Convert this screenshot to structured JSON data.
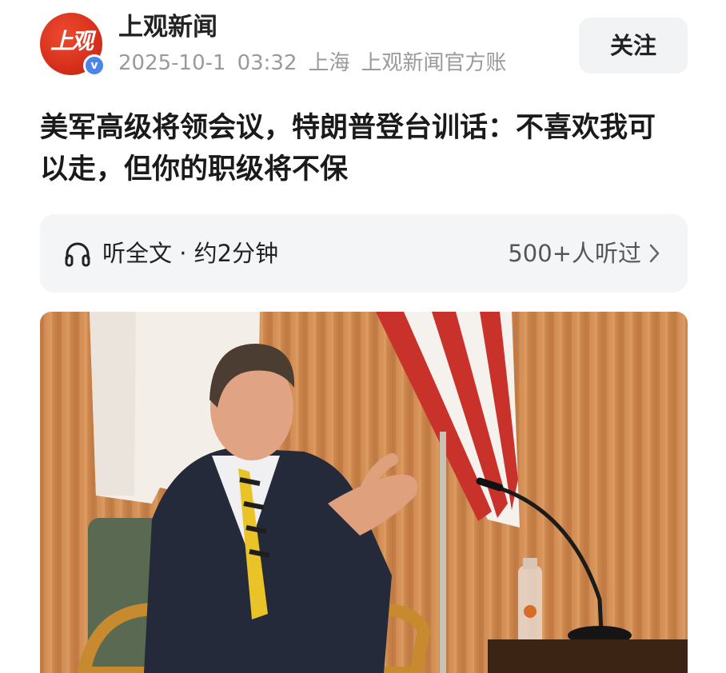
{
  "header": {
    "avatar_logo_text": "上观",
    "verified_mark": "v",
    "account_name": "上观新闻",
    "date": "2025-10-1",
    "time": "03:32",
    "location": "上海",
    "account_desc": "上观新闻官方账",
    "follow_label": "关注"
  },
  "article": {
    "title": "美军高级将领会议，特朗普登台训话：不喜欢我可以走，但你的职级将不保"
  },
  "listen": {
    "label": "听全文 · 约2分钟",
    "count": "500+人听过",
    "icon": "headphone-icon"
  },
  "colors": {
    "brand_red": "#d6301c",
    "verified_blue": "#4a86e8",
    "chip_bg": "#f2f3f5"
  }
}
